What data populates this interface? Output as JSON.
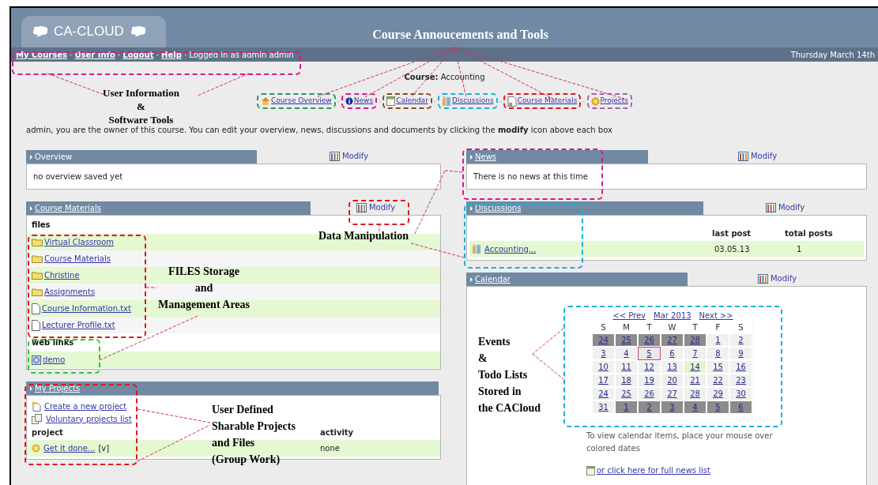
{
  "header": {
    "logo": "CA-CLOUD",
    "title": "Course Annoucements and Tools"
  },
  "user_bar": {
    "links": [
      "My Courses",
      "User Info",
      "Logout",
      "Help"
    ],
    "separator": "·",
    "logged_in": "Logged in as admin admin",
    "date": "Thursday March 14th"
  },
  "course": {
    "label": "Course:",
    "name": "Accounting"
  },
  "tools": [
    {
      "label": "Course Overview",
      "kind": "overview",
      "color": "#1f9d55"
    },
    {
      "label": "News",
      "kind": "news",
      "color": "#d6198a"
    },
    {
      "label": "Calendar",
      "kind": "calendar",
      "color": "#8a4b1a"
    },
    {
      "label": "Discussions",
      "kind": "discussions",
      "color": "#1ab0d8"
    },
    {
      "label": "Course Materials",
      "kind": "materials",
      "color": "#e0161b"
    },
    {
      "label": "Projects",
      "kind": "projects",
      "color": "#a860b0"
    }
  ],
  "tool_separator": "·",
  "owner_note": "admin, you are the owner of this course. You can edit your overview, news, discussions and documents by clicking the **modify** icon above each box",
  "left_panels": [
    {
      "kind": "text",
      "title": "Overview",
      "title_link": false,
      "modify": "Modify",
      "text": "no overview saved yet"
    },
    {
      "kind": "files",
      "title": "Course Materials",
      "title_link": true,
      "modify": "Modify",
      "files_heading": "files",
      "files": [
        {
          "name": "Virtual Classroom",
          "kind": "folder"
        },
        {
          "name": "Course Materials",
          "kind": "folder"
        },
        {
          "name": "Christine",
          "kind": "folder"
        },
        {
          "name": "Assignments",
          "kind": "folder"
        },
        {
          "name": "Course Information.txt",
          "kind": "file"
        },
        {
          "name": "Lecturer Profile.txt",
          "kind": "file"
        }
      ],
      "links_heading": "web links",
      "links": [
        {
          "name": "demo"
        }
      ]
    },
    {
      "kind": "projects",
      "title": "My Projects",
      "title_link": true,
      "actions": [
        {
          "label": "Create a new project",
          "kind": "new"
        },
        {
          "label": "Voluntary projects list",
          "kind": "list"
        }
      ],
      "columns": [
        "project",
        "activity"
      ],
      "rows": [
        {
          "name": "Get it done...",
          "tag": "[v]",
          "activity": "none"
        }
      ]
    }
  ],
  "right_panels": [
    {
      "kind": "text",
      "title": "News",
      "title_link": true,
      "modify": "Modify",
      "text": "There is no news at this time"
    },
    {
      "kind": "discussions",
      "title": "Discussions",
      "title_link": true,
      "modify": "Modify",
      "columns": [
        "last post",
        "total posts"
      ],
      "rows": [
        {
          "name": "Accounting...",
          "last_post": "03.05.13",
          "total": "1"
        }
      ]
    },
    {
      "kind": "calendar",
      "title": "Calendar",
      "title_link": true,
      "modify": "Modify",
      "prev": "<< Prev",
      "month": "Mar 2013",
      "next": "Next >>",
      "weekdays": [
        "S",
        "M",
        "T",
        "W",
        "T",
        "F",
        "S"
      ],
      "weeks": [
        [
          {
            "day": "24",
            "kind": "outside"
          },
          {
            "day": "25",
            "kind": "outside"
          },
          {
            "day": "26",
            "kind": "outside"
          },
          {
            "day": "27",
            "kind": "outside"
          },
          {
            "day": "28",
            "kind": "outside"
          },
          {
            "day": "1",
            "kind": "normal"
          },
          {
            "day": "2",
            "kind": "normal"
          }
        ],
        [
          {
            "day": "3",
            "kind": "normal"
          },
          {
            "day": "4",
            "kind": "normal"
          },
          {
            "day": "5",
            "kind": "marked"
          },
          {
            "day": "6",
            "kind": "normal"
          },
          {
            "day": "7",
            "kind": "normal"
          },
          {
            "day": "8",
            "kind": "normal"
          },
          {
            "day": "9",
            "kind": "normal"
          }
        ],
        [
          {
            "day": "10",
            "kind": "normal"
          },
          {
            "day": "11",
            "kind": "normal"
          },
          {
            "day": "12",
            "kind": "normal"
          },
          {
            "day": "13",
            "kind": "normal"
          },
          {
            "day": "14",
            "kind": "today"
          },
          {
            "day": "15",
            "kind": "normal"
          },
          {
            "day": "16",
            "kind": "normal"
          }
        ],
        [
          {
            "day": "17",
            "kind": "normal"
          },
          {
            "day": "18",
            "kind": "normal"
          },
          {
            "day": "19",
            "kind": "normal"
          },
          {
            "day": "20",
            "kind": "normal"
          },
          {
            "day": "21",
            "kind": "normal"
          },
          {
            "day": "22",
            "kind": "normal"
          },
          {
            "day": "23",
            "kind": "normal"
          }
        ],
        [
          {
            "day": "24",
            "kind": "normal"
          },
          {
            "day": "25",
            "kind": "normal"
          },
          {
            "day": "26",
            "kind": "normal"
          },
          {
            "day": "27",
            "kind": "normal"
          },
          {
            "day": "28",
            "kind": "normal"
          },
          {
            "day": "29",
            "kind": "normal"
          },
          {
            "day": "30",
            "kind": "normal"
          }
        ],
        [
          {
            "day": "31",
            "kind": "normal"
          },
          {
            "day": "1",
            "kind": "outside"
          },
          {
            "day": "2",
            "kind": "outside"
          },
          {
            "day": "3",
            "kind": "outside"
          },
          {
            "day": "4",
            "kind": "outside"
          },
          {
            "day": "5",
            "kind": "outside"
          },
          {
            "day": "6",
            "kind": "outside"
          }
        ]
      ],
      "hint": "To view calendar items, place your mouse over colored dates",
      "full_list": "or click here for full news list"
    }
  ],
  "annotations": {
    "labels": [
      {
        "lines": [
          "User Information",
          "&",
          "Software Tools"
        ]
      },
      {
        "lines": [
          "Data Manipulation"
        ]
      },
      {
        "lines": [
          "FILES Storage",
          "and",
          "Management Areas"
        ]
      },
      {
        "lines": [
          "User Defined",
          "Sharable Projects",
          "and Files",
          "(Group Work)"
        ]
      },
      {
        "lines": [
          "Events",
          "&",
          "Todo Lists",
          "Stored in",
          "the CACloud"
        ]
      }
    ],
    "highlights": [
      {
        "color": "#d6198a"
      },
      {
        "color": "#e0161b"
      },
      {
        "color": "#d6198a"
      },
      {
        "color": "#1ab0d8"
      },
      {
        "color": "#e0161b"
      },
      {
        "color": "#22cc22"
      },
      {
        "color": "#e0161b"
      },
      {
        "color": "#1ab0d8"
      }
    ]
  }
}
